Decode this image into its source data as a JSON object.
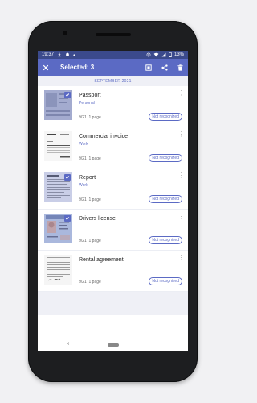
{
  "statusbar": {
    "time": "19:37",
    "battery": "13%"
  },
  "appbar": {
    "title": "Selected: 3",
    "icons": [
      "close-icon",
      "select-all-icon",
      "share-icon",
      "delete-icon"
    ]
  },
  "section": {
    "month": "SEPTEMBER 2021"
  },
  "documents": [
    {
      "title": "Passport",
      "category": "Personal",
      "date": "9/21",
      "pages": "1 page",
      "badge": "Not recognized",
      "selected": true
    },
    {
      "title": "Commercial invoice",
      "category": "Work",
      "date": "9/21",
      "pages": "1 page",
      "badge": "Not recognized",
      "selected": false
    },
    {
      "title": "Report",
      "category": "Work",
      "date": "9/21",
      "pages": "1 page",
      "badge": "Not recognized",
      "selected": true
    },
    {
      "title": "Drivers license",
      "category": "",
      "date": "9/21",
      "pages": "1 page",
      "badge": "Not recognized",
      "selected": true
    },
    {
      "title": "Rental agreement",
      "category": "",
      "date": "9/21",
      "pages": "1 page",
      "badge": "Not recognized",
      "selected": false
    }
  ],
  "colors": {
    "accent": "#5b6ac4",
    "statusbar": "#3b4a8c"
  }
}
